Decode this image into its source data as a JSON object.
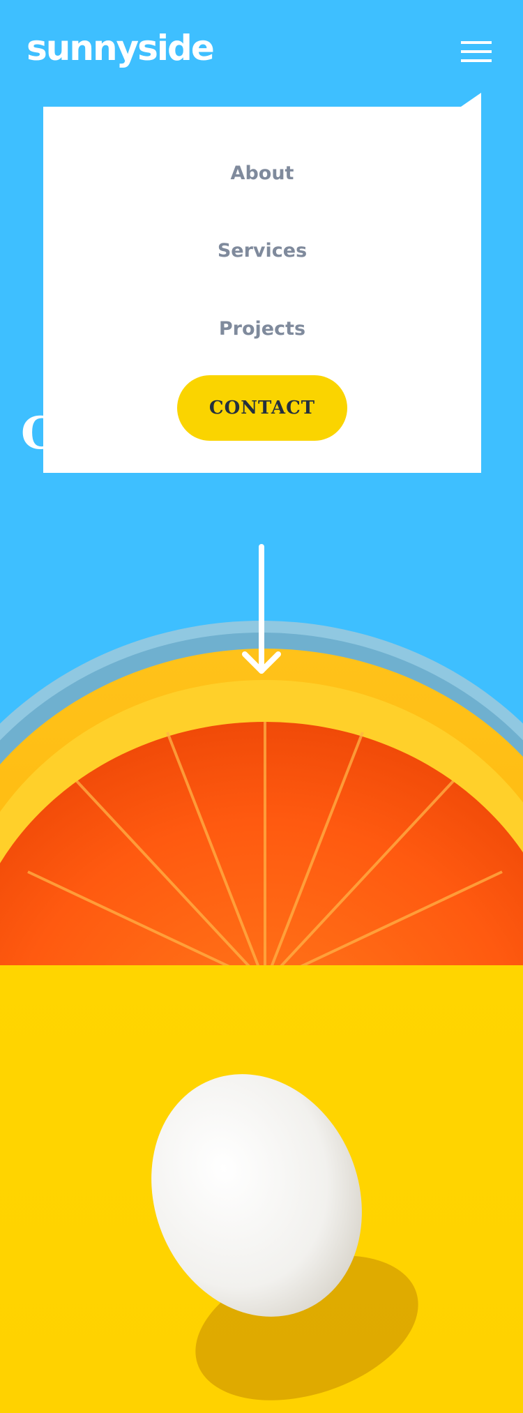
{
  "brand": {
    "logo_text": "sunnyside"
  },
  "nav": {
    "items": [
      {
        "label": "About"
      },
      {
        "label": "Services"
      },
      {
        "label": "Projects"
      }
    ],
    "contact_label": "CONTACT"
  },
  "hero": {
    "headline_fragment": "C"
  },
  "icons": {
    "menu": "hamburger-icon",
    "scroll": "arrow-down-icon"
  },
  "colors": {
    "sky_blue": "#3EBFFF",
    "menu_bg": "#FFFFFF",
    "menu_text": "#7F8A9C",
    "contact_bg": "#FAD400",
    "contact_text": "#24303E",
    "egg_bg": "#FFD400"
  }
}
